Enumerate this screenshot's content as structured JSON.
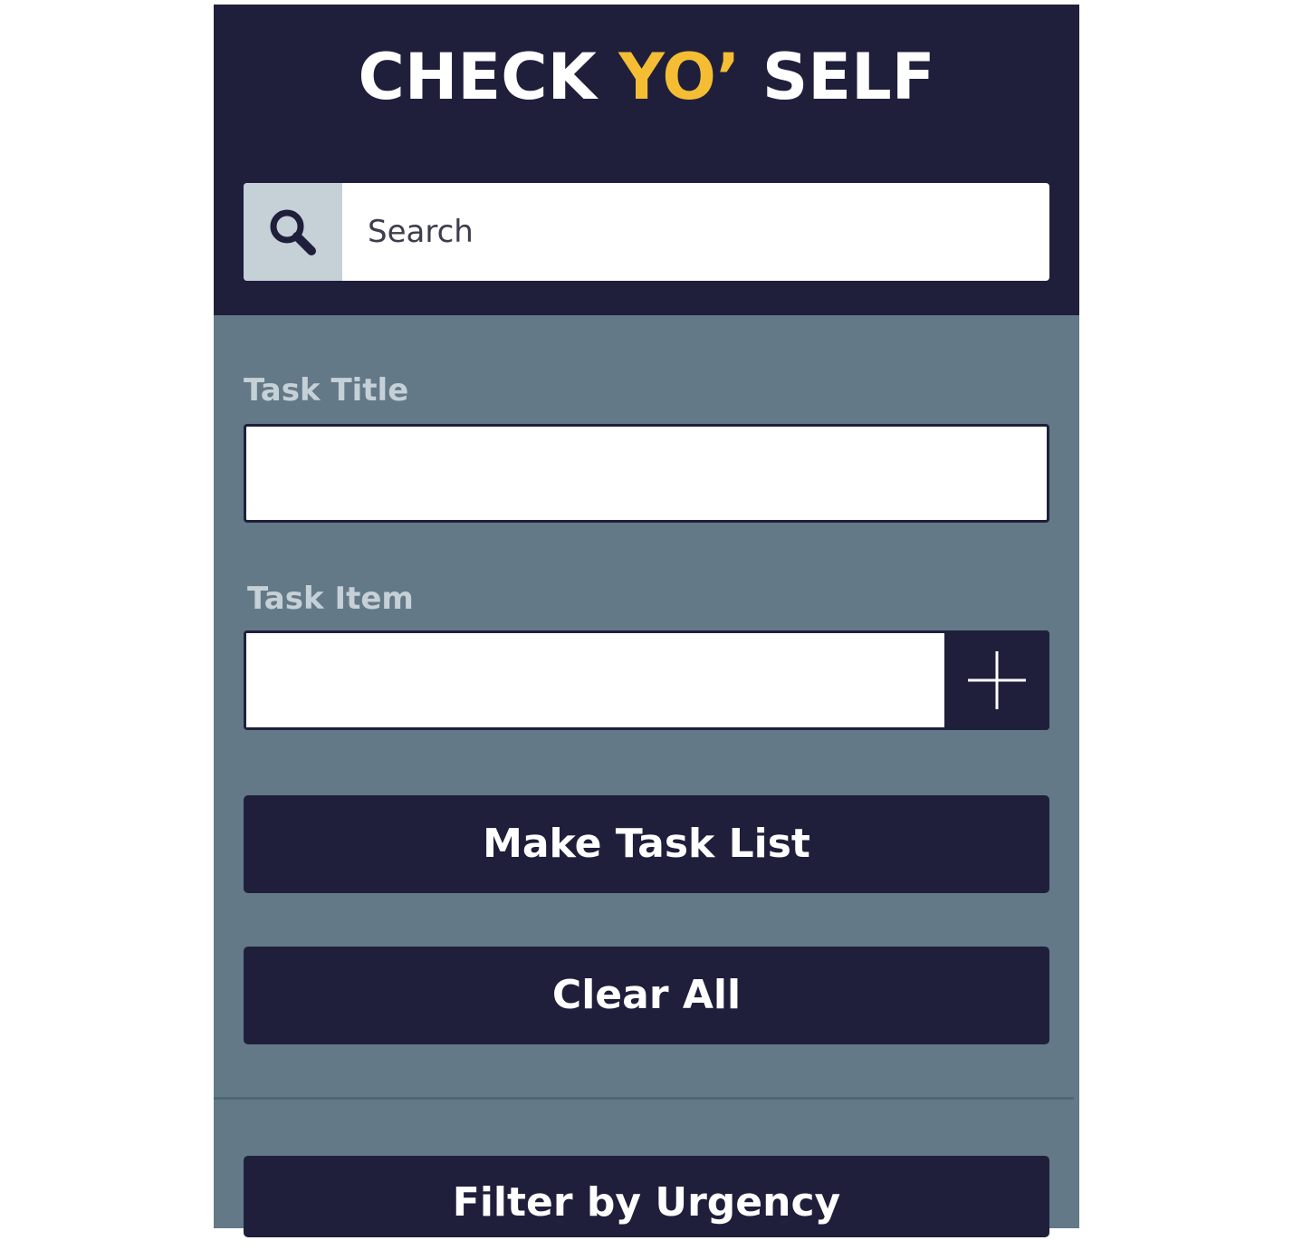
{
  "app": {
    "title_part1": "CHECK ",
    "title_accent": "YO’",
    "title_part2": " SELF"
  },
  "search": {
    "placeholder": "Search",
    "icon": "search-icon"
  },
  "form": {
    "task_title_label": "Task Title",
    "task_title_value": "",
    "task_item_label": "Task Item",
    "task_item_value": "",
    "add_item_icon": "plus-icon"
  },
  "buttons": {
    "make_task_list": "Make Task List",
    "clear_all": "Clear All",
    "filter_by_urgency": "Filter by Urgency"
  },
  "colors": {
    "navy": "#1f1f3c",
    "slate": "#637987",
    "accent": "#f5bd33",
    "label": "#c6d0d7"
  }
}
